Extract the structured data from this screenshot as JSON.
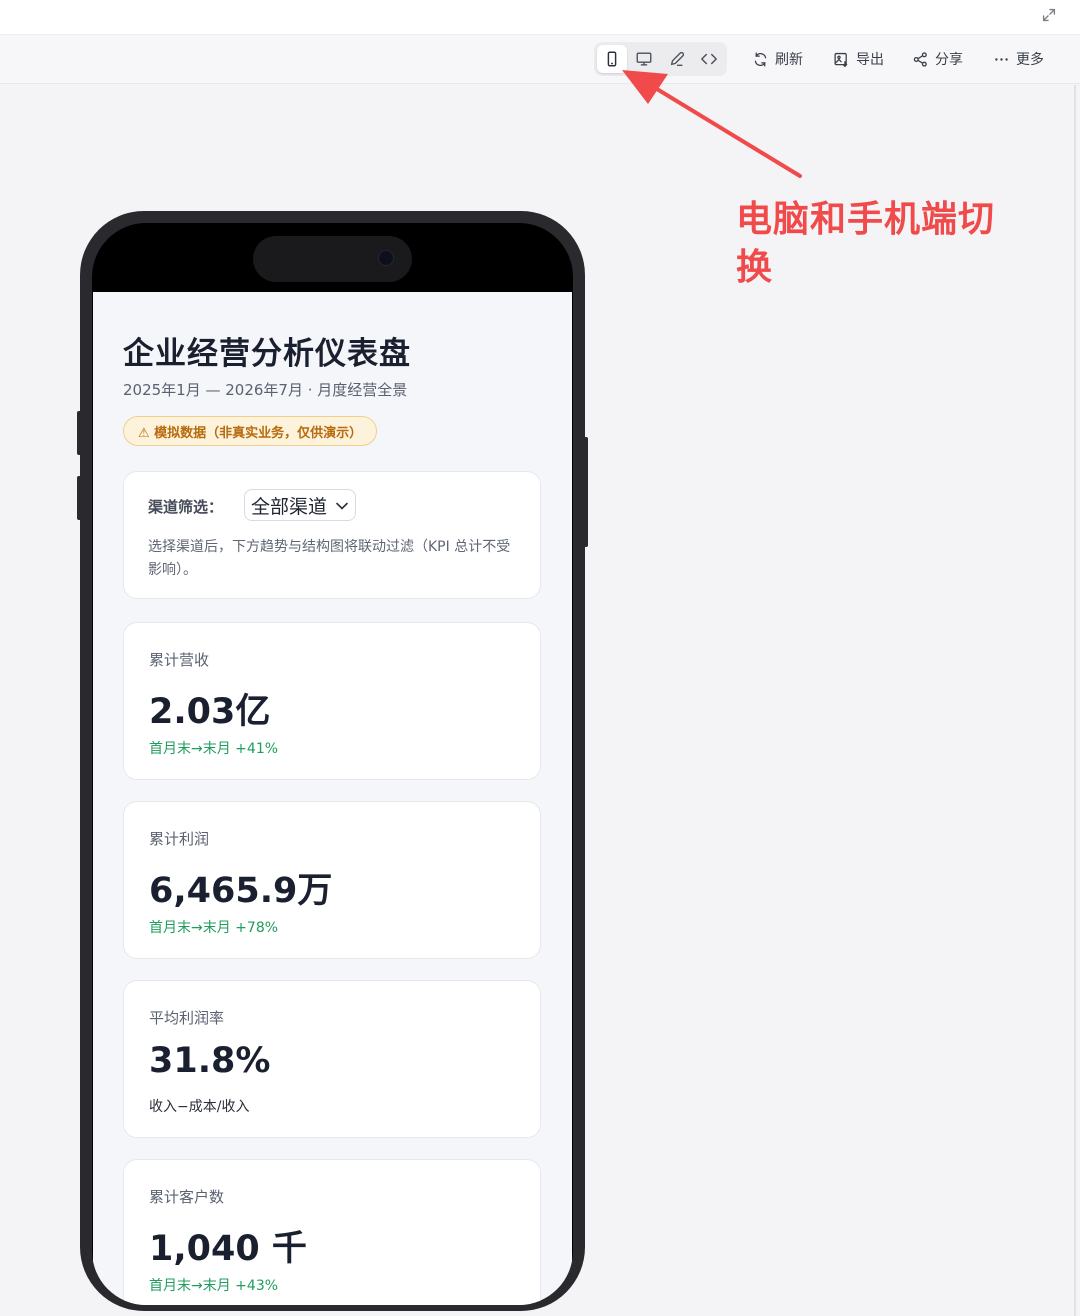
{
  "toolbar": {
    "views": [
      {
        "icon": "phone-icon",
        "active": true
      },
      {
        "icon": "monitor-icon",
        "active": false
      },
      {
        "icon": "pen-icon",
        "active": false
      },
      {
        "icon": "code-icon",
        "active": false
      }
    ],
    "actions": [
      {
        "icon": "refresh-icon",
        "label": "刷新"
      },
      {
        "icon": "image-export-icon",
        "label": "导出"
      },
      {
        "icon": "share-icon",
        "label": "分享"
      },
      {
        "icon": "more-icon",
        "label": "更多"
      }
    ]
  },
  "annotation": {
    "text": "电脑和手机端切换",
    "color": "#f04a4a"
  },
  "dashboard": {
    "title": "企业经营分析仪表盘",
    "subtitle": "2025年1月 — 2026年7月 · 月度经营全景",
    "warning": "⚠ 模拟数据（非真实业务，仅供演示）",
    "filter": {
      "label": "渠道筛选：",
      "selected": "全部渠道",
      "note": "选择渠道后，下方趋势与结构图将联动过滤（KPI 总计不受影响）。"
    },
    "kpis": [
      {
        "label": "累计营收",
        "value": "2.03亿",
        "delta": "首月末→末月 +41%"
      },
      {
        "label": "累计利润",
        "value": "6,465.9万",
        "delta": "首月末→末月 +78%"
      },
      {
        "label": "平均利润率",
        "value": "31.8%",
        "delta": "收入−成本/收入"
      },
      {
        "label": "累计客户数",
        "value": "1,040 千",
        "delta": "首月末→末月 +43%"
      }
    ]
  },
  "colors": {
    "accent_green": "#1f9d5c",
    "warning_text": "#b86a0c",
    "warning_bg": "#fdf3dc"
  }
}
